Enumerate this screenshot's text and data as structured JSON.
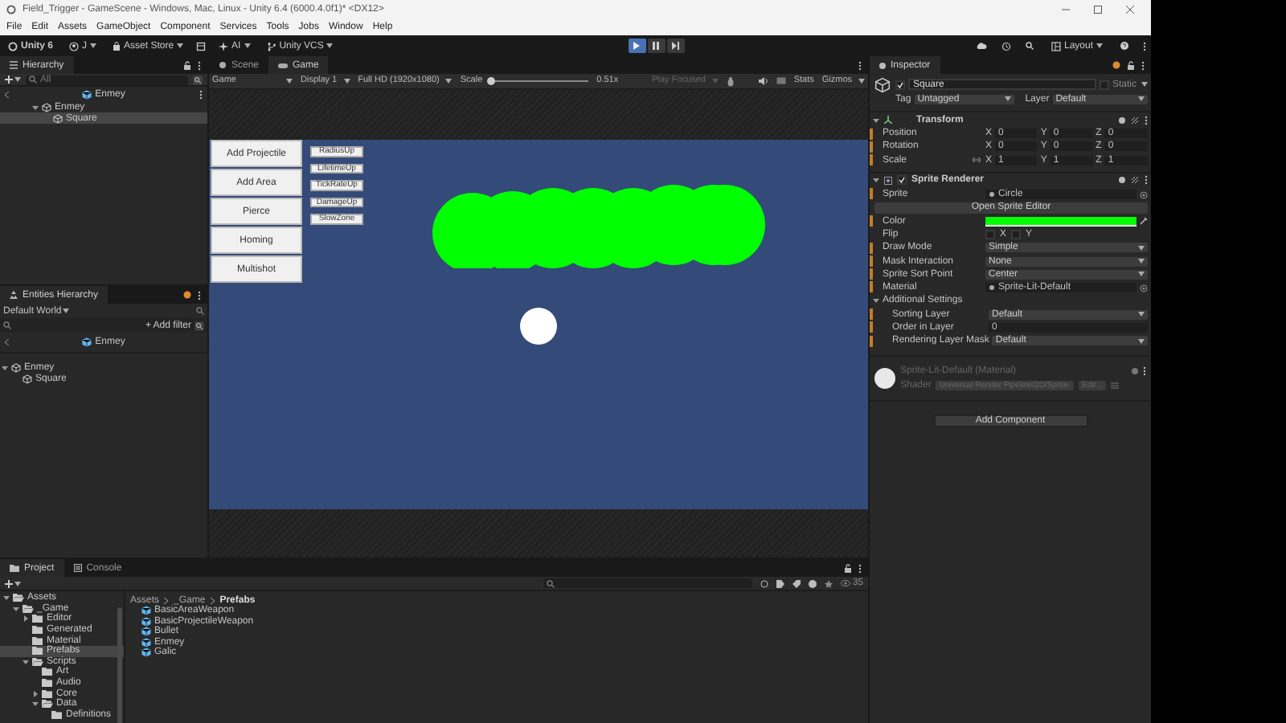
{
  "window": {
    "title": "Field_Trigger - GameScene - Windows, Mac, Linux - Unity 6.4 (6000.4.0f1)* <DX12>"
  },
  "menu": [
    "File",
    "Edit",
    "Assets",
    "GameObject",
    "Component",
    "Services",
    "Tools",
    "Jobs",
    "Window",
    "Help"
  ],
  "toolbar": {
    "items": [
      {
        "kind": "unity",
        "label": "Unity 6"
      },
      {
        "kind": "account",
        "label": "J"
      },
      {
        "kind": "store",
        "label": "Asset Store"
      },
      {
        "kind": "ai",
        "label": "AI"
      },
      {
        "kind": "vcs",
        "label": "Unity VCS"
      }
    ],
    "play_controls": [
      {
        "kind": "play",
        "selected": true
      },
      {
        "kind": "pause",
        "selected": false
      },
      {
        "kind": "step",
        "selected": false
      }
    ],
    "layout": "Layout"
  },
  "hierarchy": {
    "tab": "Hierarchy",
    "search_placeholder": "All",
    "header": "Enmey",
    "tree": [
      {
        "label": "Enmey",
        "expanded": true,
        "selected": false,
        "children": [
          {
            "label": "Square",
            "selected": true
          }
        ]
      }
    ]
  },
  "entities_hierarchy": {
    "tab": "Entities Hierarchy",
    "world": "Default World",
    "add_filter": "+ Add filter",
    "header": "Enmey",
    "tree": [
      {
        "label": "Enmey",
        "expanded": true,
        "selected": false,
        "children": [
          {
            "label": "Square",
            "selected": false
          }
        ]
      }
    ]
  },
  "view_tabs": [
    {
      "label": "Scene",
      "selected": false
    },
    {
      "label": "Game",
      "selected": true
    }
  ],
  "game_toolbar": {
    "mode": "Game",
    "display": "Display 1",
    "resolution": "Full HD (1920x1080)",
    "scale_label": "Scale",
    "scale": {
      "level": 0
    },
    "scale_reading": "0.51x",
    "play_mode": "Play Focused",
    "stats": "Stats",
    "gizmos": "Gizmos"
  },
  "game_view": {
    "buttons": [
      "Add Projectile",
      "Add Area",
      "Pierce",
      "Homing",
      "Multishot"
    ],
    "small_buttons": [
      "RadiusUp",
      "LifetimeUp",
      "TickRateUp",
      "DamageUp",
      "SlowZone"
    ]
  },
  "inspector": {
    "tab": "Inspector",
    "name": "Square",
    "active": true,
    "static_label": "Static",
    "static": false,
    "tag_label": "Tag",
    "tag": "Untagged",
    "layer_label": "Layer",
    "layer": "Default",
    "transform": {
      "title": "Transform",
      "expanded": true,
      "rows": [
        {
          "label": "Position",
          "fields": [
            {
              "axis": "X",
              "value": "0"
            },
            {
              "axis": "Y",
              "value": "0"
            },
            {
              "axis": "Z",
              "value": "0"
            }
          ]
        },
        {
          "label": "Rotation",
          "fields": [
            {
              "axis": "X",
              "value": "0"
            },
            {
              "axis": "Y",
              "value": "0"
            },
            {
              "axis": "Z",
              "value": "0"
            }
          ]
        },
        {
          "label": "Scale",
          "fields": [
            {
              "axis": "X",
              "value": "1"
            },
            {
              "axis": "Y",
              "value": "1"
            },
            {
              "axis": "Z",
              "value": "1"
            }
          ]
        }
      ]
    },
    "sprite_renderer": {
      "title": "Sprite Renderer",
      "enabled": true,
      "expanded": true,
      "rows": [
        {
          "kind": "object",
          "label": "Sprite",
          "value": "Circle"
        },
        {
          "kind": "button",
          "label": "Open Sprite Editor"
        },
        {
          "kind": "color",
          "label": "Color",
          "color": "#00ff00"
        },
        {
          "kind": "flip",
          "label": "Flip",
          "options": [
            {
              "label": "X",
              "checked": false
            },
            {
              "label": "Y",
              "checked": false
            }
          ]
        },
        {
          "kind": "dropdown",
          "label": "Draw Mode",
          "value": "Simple"
        },
        {
          "kind": "dropdown",
          "label": "Mask Interaction",
          "value": "None"
        },
        {
          "kind": "dropdown",
          "label": "Sprite Sort Point",
          "value": "Center"
        },
        {
          "kind": "object",
          "label": "Material",
          "value": "Sprite-Lit-Default"
        },
        {
          "kind": "section",
          "label": "Additional Settings",
          "expanded": true,
          "children": [
            {
              "kind": "dropdown",
              "label": "Sorting Layer",
              "value": "Default"
            },
            {
              "kind": "text",
              "label": "Order in Layer",
              "value": "0"
            },
            {
              "kind": "dropdown",
              "label": "Rendering Layer Mask",
              "value": "Default"
            }
          ]
        }
      ]
    },
    "material": {
      "title": "Sprite-Lit-Default (Material)",
      "shader_label": "Shader",
      "shader": "Universal Render Pipeline/2D/Sprite-",
      "edit": "Edit..."
    },
    "add_component": "Add Component"
  },
  "project": {
    "tabs": [
      {
        "label": "Project",
        "selected": true
      },
      {
        "label": "Console",
        "selected": false
      }
    ],
    "count": "35",
    "tree": [
      {
        "label": "Assets",
        "expanded": true,
        "selected": false,
        "children": [
          {
            "label": "_Game",
            "expanded": true,
            "selected": false,
            "children": [
              {
                "label": "Editor",
                "expanded": false,
                "selected": false
              },
              {
                "label": "Generated",
                "selected": false
              },
              {
                "label": "Material",
                "selected": false
              },
              {
                "label": "Prefabs",
                "selected": true
              },
              {
                "label": "Scripts",
                "expanded": true,
                "selected": false,
                "children": [
                  {
                    "label": "Art",
                    "selected": false
                  },
                  {
                    "label": "Audio",
                    "selected": false
                  },
                  {
                    "label": "Core",
                    "expanded": false,
                    "selected": false
                  },
                  {
                    "label": "Data",
                    "expanded": true,
                    "selected": false,
                    "children": [
                      {
                        "label": "Definitions",
                        "selected": false
                      }
                    ]
                  }
                ]
              }
            ]
          }
        ]
      }
    ],
    "breadcrumb": [
      "Assets",
      "_Game",
      "Prefabs"
    ],
    "assets": [
      "BasicAreaWeapon",
      "BasicProjectileWeapon",
      "Bullet",
      "Enmey",
      "Galic"
    ]
  }
}
